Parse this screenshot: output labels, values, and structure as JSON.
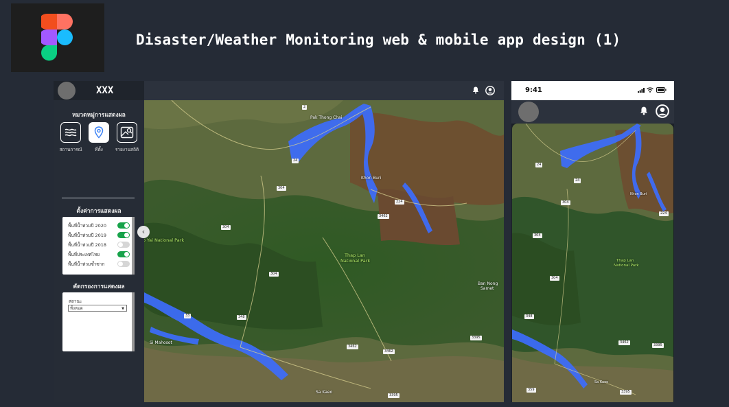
{
  "page": {
    "heading": "Disaster/Weather Monitoring web & mobile app design (1)"
  },
  "desktop": {
    "brand": "XXX",
    "categories_title": "หมวดหมู่การแสดงผล",
    "categories": [
      {
        "label": "สถานการณ์",
        "icon": "water-waves-icon",
        "active": false
      },
      {
        "label": "ที่ตั้ง",
        "icon": "location-pin-icon",
        "active": true
      },
      {
        "label": "รายงานสถิติ",
        "icon": "image-stats-icon",
        "active": false
      }
    ],
    "display_settings_title": "ตั้งค่าการแสดงผล",
    "toggles": [
      {
        "label": "พื้นที่น้ำท่วมปี 2020",
        "on": true
      },
      {
        "label": "พื้นที่น้ำท่วมปี 2019",
        "on": true
      },
      {
        "label": "พื้นที่น้ำท่วมปี 2018",
        "on": false
      },
      {
        "label": "พื้นที่ประเทศไทย",
        "on": true
      },
      {
        "label": "พื้นที่น้ำท่วมซ้ำซาก",
        "on": false
      }
    ],
    "filter_title": "คัดกรองการแสดงผล",
    "filter_label": "สถานะ",
    "filter_value": "ทั้งหมด"
  },
  "mobile": {
    "time": "9:41"
  },
  "map": {
    "labels": {
      "park_full": "Thap Lan\nNational Park",
      "park_line1": "Thap Lan",
      "park_line2": "National Park",
      "yai_park": "o Yai National Park",
      "ban_nong_line1": "Ban Nong",
      "ban_nong_line2": "Samet",
      "khon_buri": "Khon Buri",
      "sa_kaeo": "Sa Kaeo",
      "pak_thong_chai": "Pak Thong Chai",
      "mueang": "Si Mahosot"
    },
    "roads": [
      "2",
      "24",
      "304",
      "3462",
      "348",
      "33",
      "359",
      "3395",
      "224",
      "3485"
    ]
  },
  "colors": {
    "background": "#252b36",
    "flood": "#3d6dfc",
    "toggle_on": "#17a34a"
  }
}
